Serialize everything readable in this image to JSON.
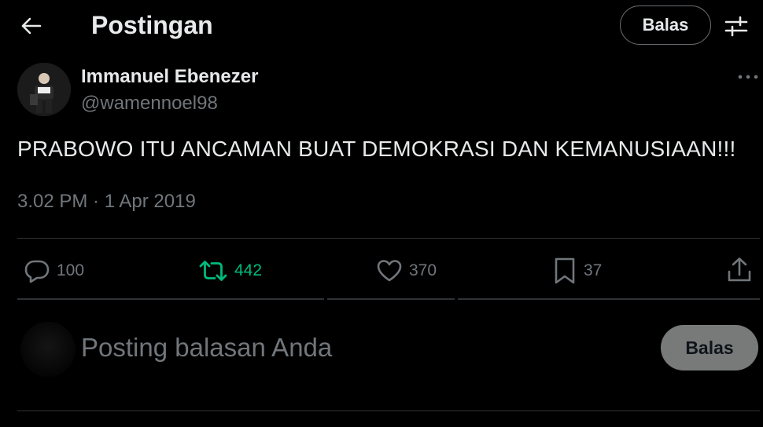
{
  "header": {
    "title": "Postingan",
    "reply_label": "Balas"
  },
  "post": {
    "author_name": "Immanuel Ebenezer",
    "author_handle": "@wamennoel98",
    "text": "PRABOWO ITU ANCAMAN BUAT DEMOKRASI DAN KEMANUSIAAN!!!",
    "timestamp": "3.02 PM · 1 Apr 2019"
  },
  "actions": {
    "replies": "100",
    "reposts": "442",
    "likes": "370",
    "bookmarks": "37"
  },
  "composer": {
    "placeholder": "Posting balasan Anda",
    "reply_label": "Balas"
  },
  "icons": [
    "back-arrow-icon",
    "tune-icon",
    "more-icon",
    "reply-icon",
    "repost-icon",
    "like-icon",
    "bookmark-icon",
    "share-icon"
  ],
  "colors": {
    "background": "#000000",
    "text": "#e7e9ea",
    "secondary_text": "#71767b",
    "repost_active": "#00ba7c",
    "divider": "#2f3336",
    "reply_button_bg": "#787a7a"
  }
}
